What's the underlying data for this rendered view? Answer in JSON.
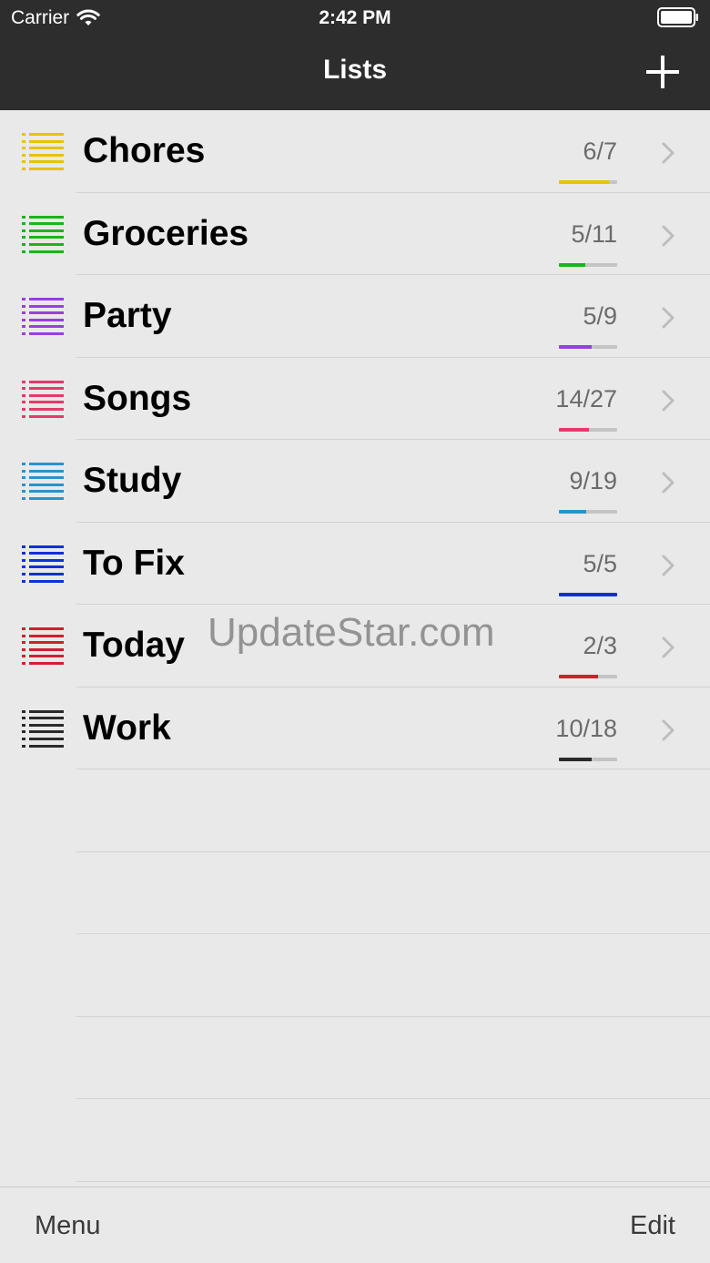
{
  "status_bar": {
    "carrier": "Carrier",
    "time": "2:42 PM"
  },
  "nav": {
    "title": "Lists",
    "add_icon": "plus-icon"
  },
  "lists": [
    {
      "title": "Chores",
      "count": "6/7",
      "done": 6,
      "total": 7,
      "color": "#e5c400"
    },
    {
      "title": "Groceries",
      "count": "5/11",
      "done": 5,
      "total": 11,
      "color": "#1bb41b"
    },
    {
      "title": "Party",
      "count": "5/9",
      "done": 5,
      "total": 9,
      "color": "#9a3ee0"
    },
    {
      "title": "Songs",
      "count": "14/27",
      "done": 14,
      "total": 27,
      "color": "#e6396b"
    },
    {
      "title": "Study",
      "count": "9/19",
      "done": 9,
      "total": 19,
      "color": "#2a93c9"
    },
    {
      "title": "To Fix",
      "count": "5/5",
      "done": 5,
      "total": 5,
      "color": "#1030d8"
    },
    {
      "title": "Today",
      "count": "2/3",
      "done": 2,
      "total": 3,
      "color": "#d11f2c"
    },
    {
      "title": "Work",
      "count": "10/18",
      "done": 10,
      "total": 18,
      "color": "#2a2a2a"
    }
  ],
  "watermark": "UpdateStar.com",
  "toolbar": {
    "menu_label": "Menu",
    "edit_label": "Edit"
  }
}
